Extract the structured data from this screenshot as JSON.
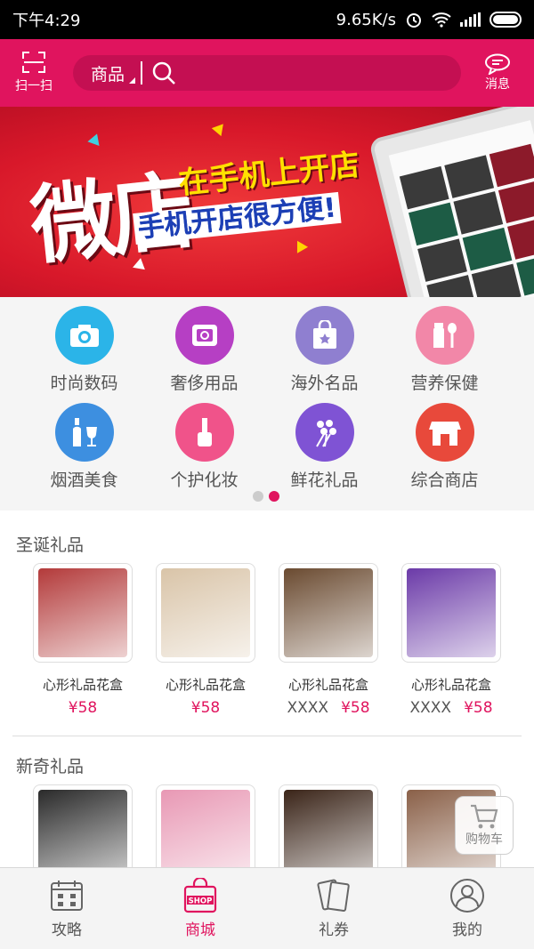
{
  "status": {
    "time": "下午4:29",
    "speed": "9.65K/s"
  },
  "header": {
    "scan_label": "扫一扫",
    "search_category": "商品",
    "message_label": "消息"
  },
  "banner": {
    "big_char": "微店",
    "line1": "在手机上开店",
    "line2": "手机开店很方便!"
  },
  "categories": [
    {
      "label": "时尚数码",
      "color": "#2bb4e8",
      "icon": "camera-icon"
    },
    {
      "label": "奢侈用品",
      "color": "#b63fc4",
      "icon": "ring-box-icon"
    },
    {
      "label": "海外名品",
      "color": "#8f7fd0",
      "icon": "shopping-bag-icon"
    },
    {
      "label": "营养保健",
      "color": "#f287a8",
      "icon": "bottle-spoon-icon"
    },
    {
      "label": "烟酒美食",
      "color": "#3d8fe0",
      "icon": "wine-icon"
    },
    {
      "label": "个护化妆",
      "color": "#f0538a",
      "icon": "nail-polish-icon"
    },
    {
      "label": "鲜花礼品",
      "color": "#7f53d4",
      "icon": "flower-bouquet-icon"
    },
    {
      "label": "综合商店",
      "color": "#e8493b",
      "icon": "store-icon"
    }
  ],
  "pager": {
    "pages": 2,
    "active": 2
  },
  "sections": [
    {
      "title": "圣诞礼品",
      "products": [
        {
          "name": "心形礼品花盒",
          "old": "",
          "price": "¥58",
          "img": "#b33a3a"
        },
        {
          "name": "心形礼品花盒",
          "old": "",
          "price": "¥58",
          "img": "#d9c4a8"
        },
        {
          "name": "心形礼品花盒",
          "old": "XXXX",
          "price": "¥58",
          "img": "#6a4a30"
        },
        {
          "name": "心形礼品花盒",
          "old": "XXXX",
          "price": "¥58",
          "img": "#6b3aa8"
        }
      ]
    },
    {
      "title": "新奇礼品",
      "products": [
        {
          "name": "",
          "old": "",
          "price": "",
          "img": "#2a2a2a"
        },
        {
          "name": "",
          "old": "",
          "price": "",
          "img": "#e898b4"
        },
        {
          "name": "",
          "old": "",
          "price": "",
          "img": "#3a2418"
        },
        {
          "name": "",
          "old": "",
          "price": "",
          "img": "#8a6048"
        }
      ]
    }
  ],
  "cart_label": "购物车",
  "tabs": [
    {
      "label": "攻略",
      "icon": "calendar-icon",
      "active": false
    },
    {
      "label": "商城",
      "icon": "shop-bag-icon",
      "active": true
    },
    {
      "label": "礼券",
      "icon": "coupon-cards-icon",
      "active": false
    },
    {
      "label": "我的",
      "icon": "person-icon",
      "active": false
    }
  ]
}
